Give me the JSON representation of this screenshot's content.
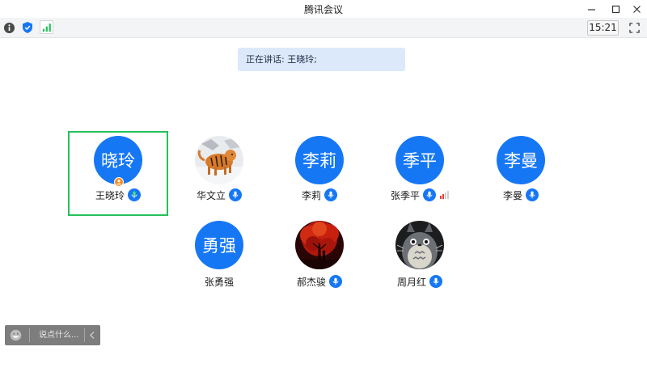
{
  "window": {
    "title": "腾讯会议",
    "controls": [
      "minimize-icon",
      "maximize-icon",
      "close-icon"
    ]
  },
  "toolbar": {
    "icons": [
      "info-icon",
      "shield-icon",
      "signal-icon",
      "fullscreen-icon"
    ],
    "time": "15:21",
    "accent": "#1677f5",
    "signal_color": "#24c15a"
  },
  "speaking": {
    "text": "正在讲话: 王晓玲;"
  },
  "participants": [
    {
      "name": "王晓玲",
      "avatar_text": "晓玲",
      "avatar_type": "text",
      "host": true,
      "active": true,
      "mic": "on-speaking"
    },
    {
      "name": "华文立",
      "avatar_text": "",
      "avatar_type": "photo-tiger",
      "host": false,
      "active": false,
      "mic": "on"
    },
    {
      "name": "李莉",
      "avatar_text": "李莉",
      "avatar_type": "text",
      "host": false,
      "active": false,
      "mic": "on"
    },
    {
      "name": "张季平",
      "avatar_text": "季平",
      "avatar_type": "text",
      "host": false,
      "active": false,
      "mic": "on",
      "weak_signal": true
    },
    {
      "name": "李曼",
      "avatar_text": "李曼",
      "avatar_type": "text",
      "host": false,
      "active": false,
      "mic": "on"
    },
    {
      "name": "张勇强",
      "avatar_text": "勇强",
      "avatar_type": "text",
      "host": false,
      "active": false,
      "mic": "none"
    },
    {
      "name": "郝杰骏",
      "avatar_text": "",
      "avatar_type": "photo-red-tree",
      "host": false,
      "active": false,
      "mic": "on"
    },
    {
      "name": "周月红",
      "avatar_text": "",
      "avatar_type": "photo-totoro",
      "host": false,
      "active": false,
      "mic": "on"
    }
  ],
  "chat": {
    "placeholder": "说点什么...",
    "icons": [
      "emoji-icon",
      "chevron-left-icon"
    ]
  },
  "colors": {
    "avatar_blue": "#1677f5",
    "active_border": "#24c15a",
    "host_badge": "#f28c1e",
    "banner_bg": "#dce9fb"
  }
}
